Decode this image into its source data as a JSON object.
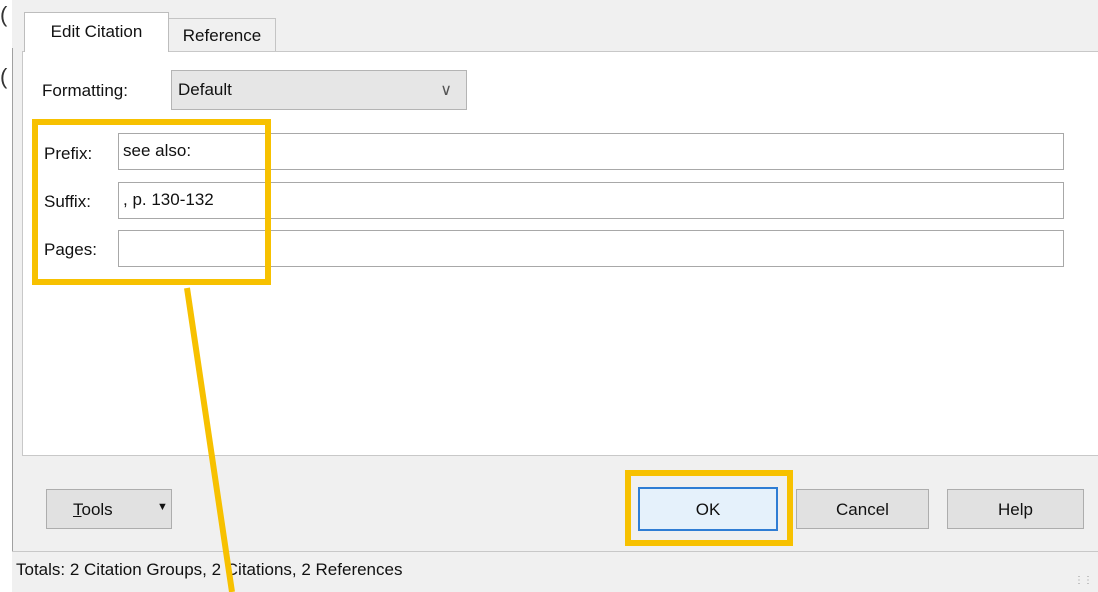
{
  "tabs": [
    {
      "label": "Edit Citation",
      "active": true
    },
    {
      "label": "Reference",
      "active": false
    }
  ],
  "formatting": {
    "label": "Formatting:",
    "value": "Default"
  },
  "fields": {
    "prefix": {
      "label": "Prefix:",
      "value": "see also:"
    },
    "suffix": {
      "label": "Suffix:",
      "value": ", p. 130-132"
    },
    "pages": {
      "label": "Pages:",
      "value": ""
    }
  },
  "buttons": {
    "tools_mnemonic": "T",
    "tools_rest": "ools",
    "ok": "OK",
    "cancel": "Cancel",
    "help": "Help"
  },
  "status": {
    "text": "Totals: 2 Citation Groups, 2 Citations, 2 References"
  },
  "icons": {
    "dropdown": "chevron-down-icon",
    "tools_menu": "caret-down-icon",
    "resize": "resize-grip-icon"
  },
  "colors": {
    "highlight": "#f7c100",
    "ok_border": "#2f7dd4",
    "dialog_bg": "#f0f0f0"
  }
}
